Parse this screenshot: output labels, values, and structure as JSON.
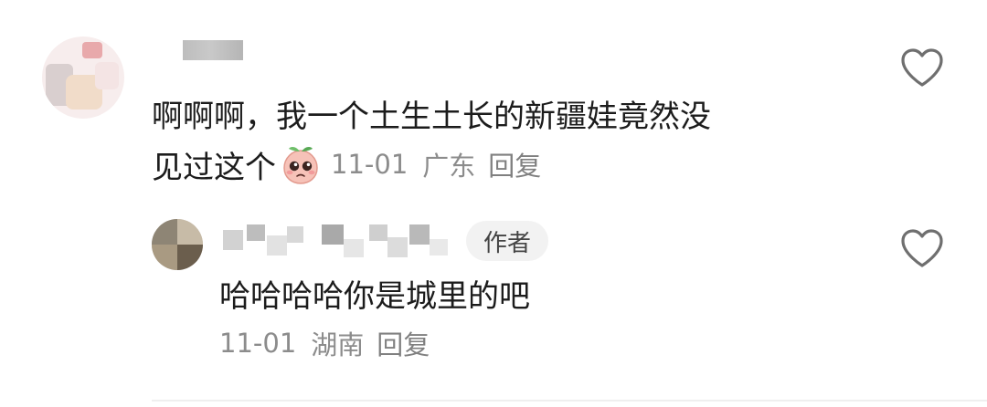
{
  "comment": {
    "text": "啊啊啊，我一个土生土长的新疆娃竟然没",
    "text_line2": "见过这个",
    "emoji_name": "peach-crying-emoji",
    "date": "11-01",
    "location": "广东",
    "reply_label": "回复",
    "like_icon": "heart-outline-icon"
  },
  "reply": {
    "author_badge": "作者",
    "text": "哈哈哈哈你是城里的吧",
    "date": "11-01",
    "location": "湖南",
    "reply_label": "回复",
    "like_icon": "heart-outline-icon"
  },
  "colors": {
    "text": "#1c1c1c",
    "meta": "#8c8c8c",
    "badge_bg": "#f2f2f2",
    "divider": "#efefef"
  }
}
